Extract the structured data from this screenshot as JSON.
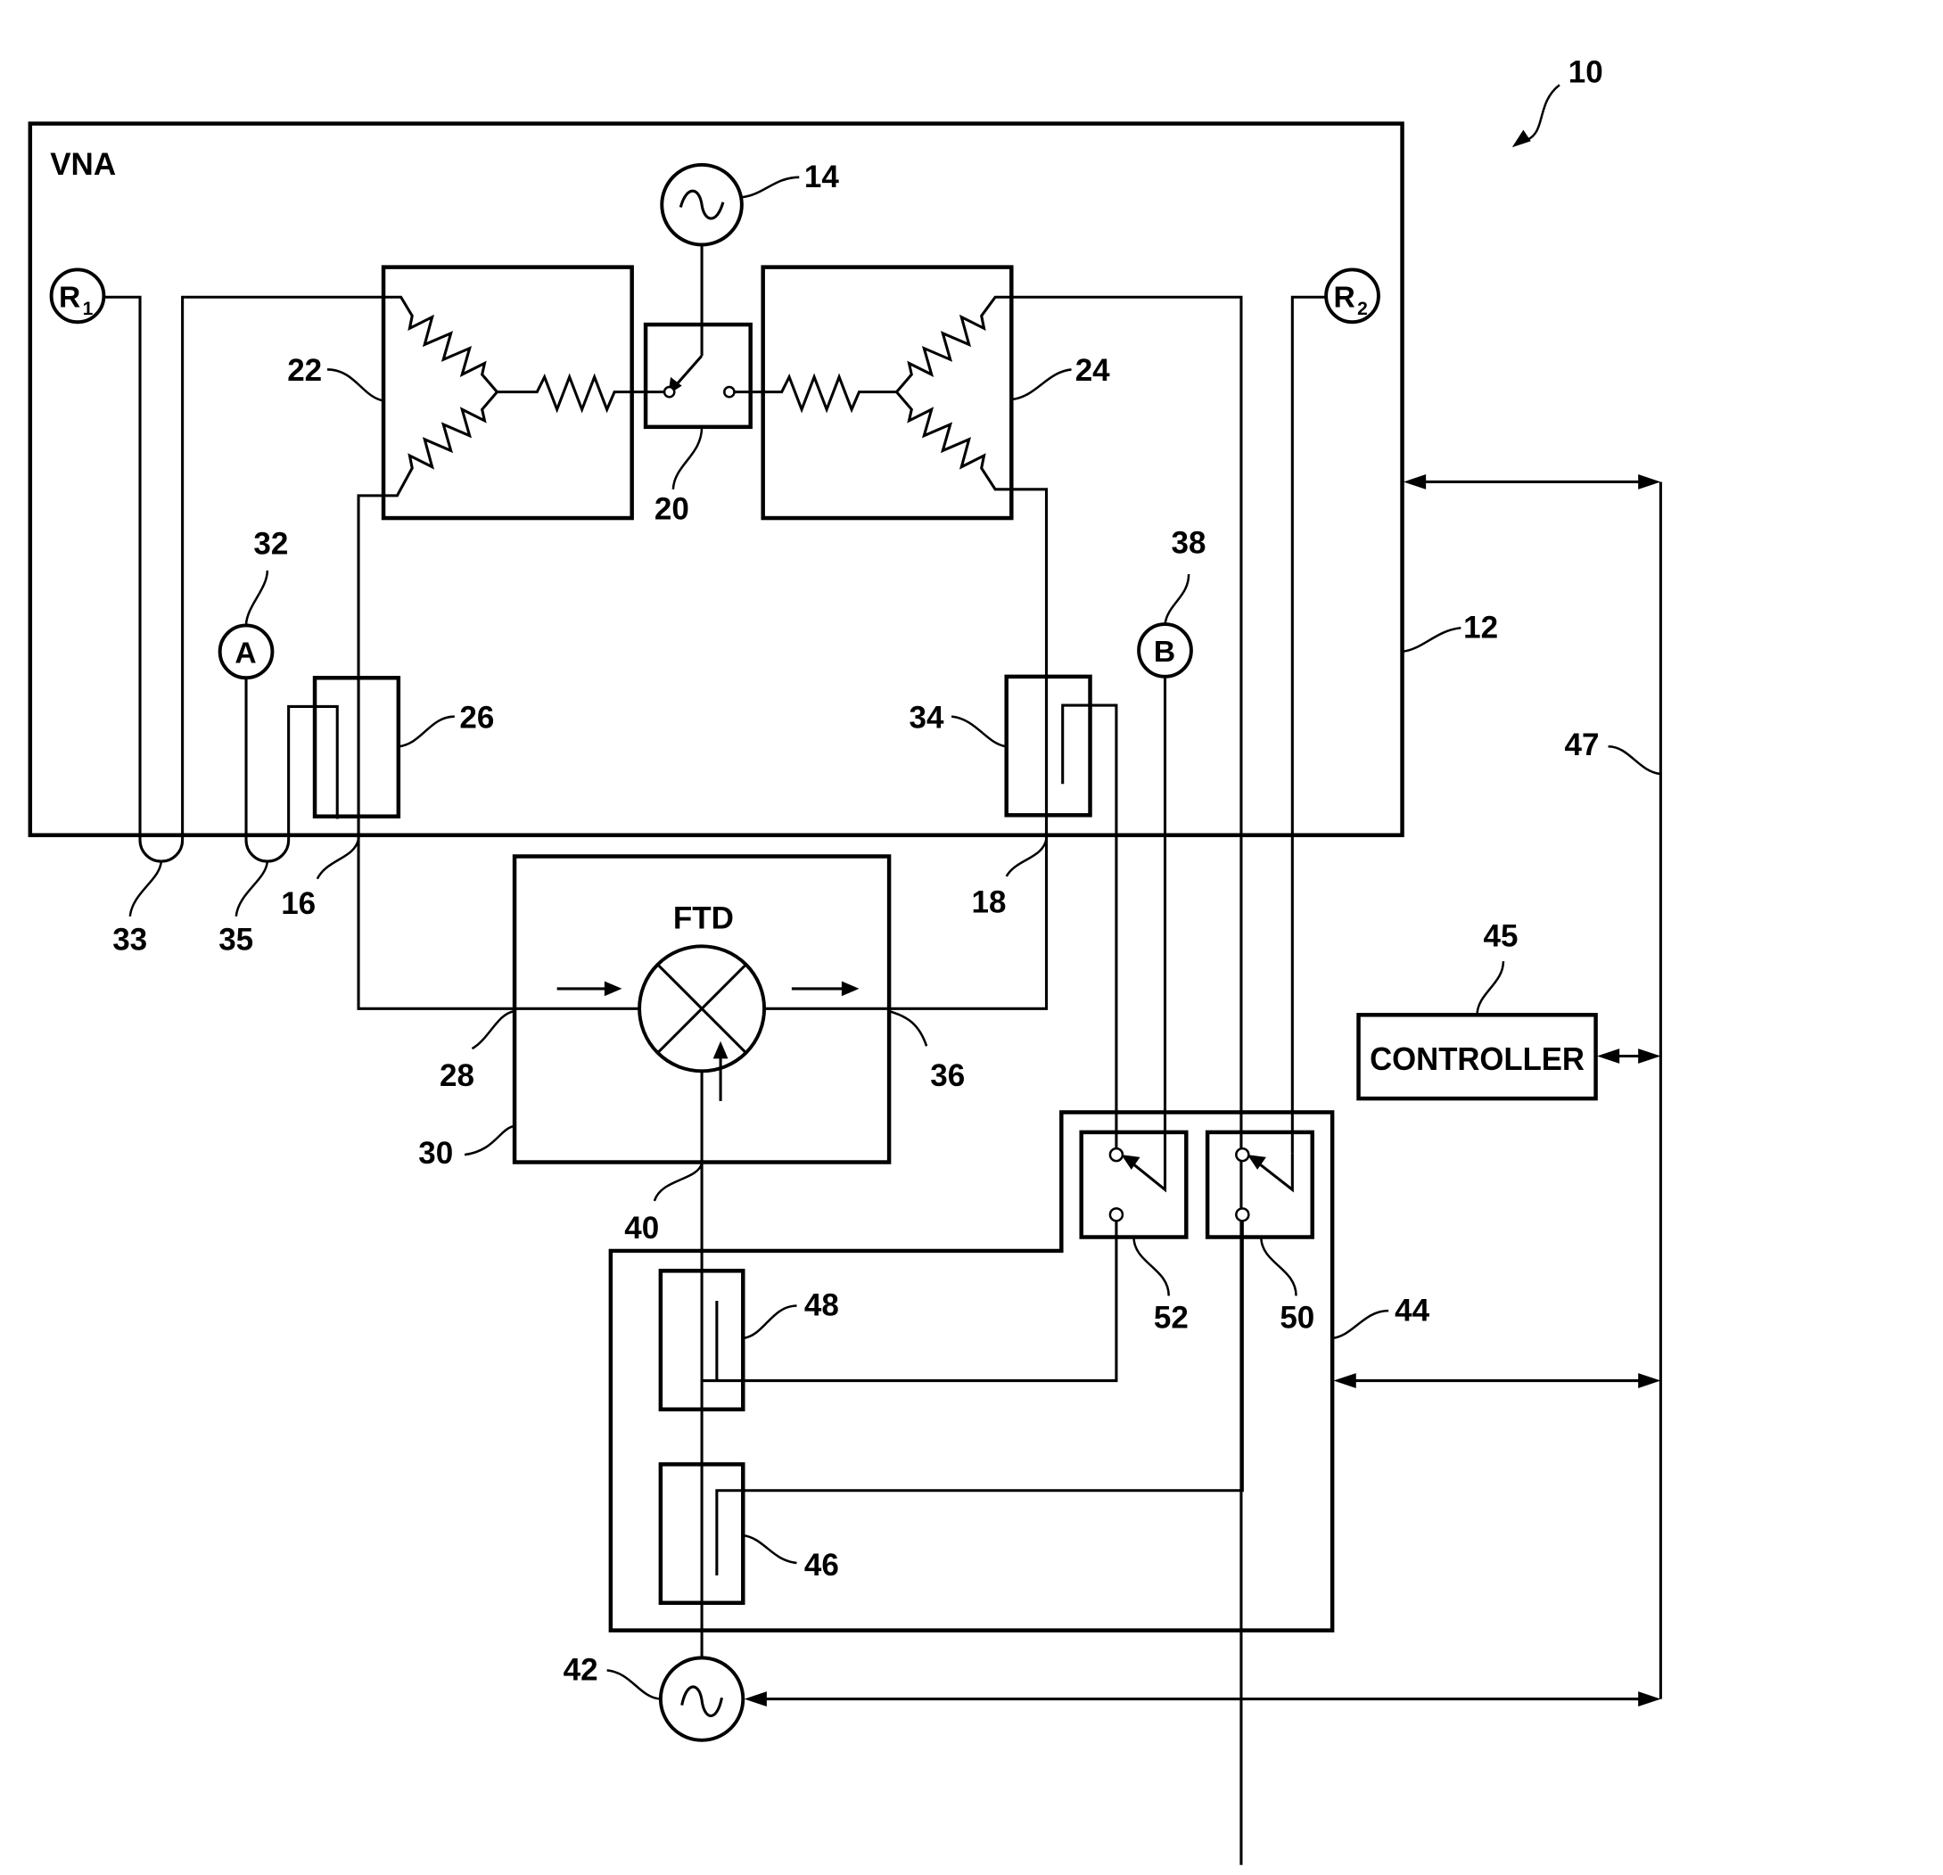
{
  "figure": {
    "title_ref": "10",
    "blocks": {
      "vna": {
        "label": "VNA",
        "ref": "12"
      },
      "ftd": {
        "label": "FTD",
        "ref": "30"
      },
      "controller": {
        "label": "CONTROLLER",
        "ref": "45"
      },
      "switch_module": {
        "ref": "44"
      }
    },
    "receivers": {
      "r1": {
        "letter": "R",
        "subscript": "1"
      },
      "r2": {
        "letter": "R",
        "subscript": "2"
      },
      "a": {
        "letter": "A",
        "ref": "32"
      },
      "b": {
        "letter": "B",
        "ref": "38"
      }
    },
    "sources": {
      "vna_source": {
        "ref": "14"
      },
      "lo_source": {
        "ref": "42"
      }
    },
    "components": {
      "splitter_1": {
        "ref": "22"
      },
      "splitter_2": {
        "ref": "24"
      },
      "transfer_switch": {
        "ref": "20"
      },
      "coupler_port1": {
        "ref": "26"
      },
      "coupler_port2": {
        "ref": "34"
      },
      "coupler_48": {
        "ref": "48"
      },
      "coupler_46": {
        "ref": "46"
      },
      "switch_52": {
        "ref": "52"
      },
      "switch_50": {
        "ref": "50"
      },
      "bus": {
        "ref": "47"
      }
    },
    "ports": {
      "port1": {
        "ref": "16"
      },
      "port2": {
        "ref": "18"
      },
      "ftd_in": {
        "ref": "28"
      },
      "ftd_out": {
        "ref": "36"
      },
      "ftd_lo": {
        "ref": "40"
      },
      "loop_r1": {
        "ref": "33"
      },
      "loop_a": {
        "ref": "35"
      }
    }
  }
}
